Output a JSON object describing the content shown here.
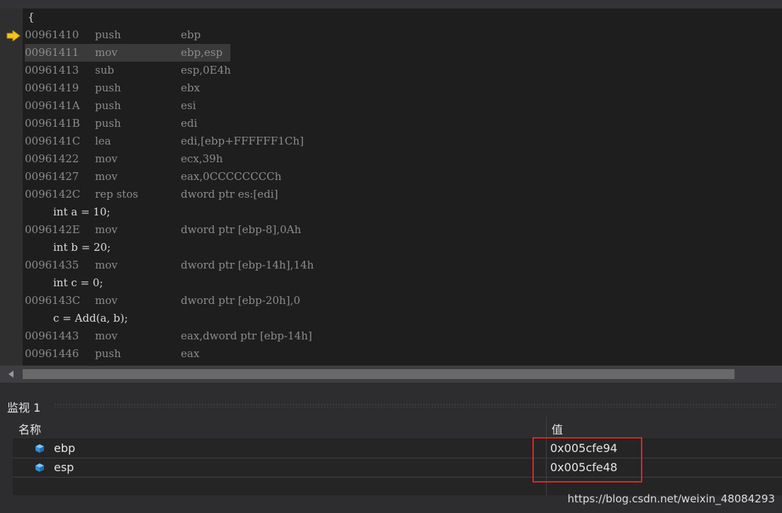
{
  "disassembly": {
    "lines": [
      {
        "type": "src",
        "text": "{"
      },
      {
        "type": "asm",
        "addr": "00961410",
        "op": "push",
        "arg": "ebp",
        "current": true
      },
      {
        "type": "asm",
        "addr": "00961411",
        "op": "mov",
        "arg": "ebp,esp",
        "highlight": true
      },
      {
        "type": "asm",
        "addr": "00961413",
        "op": "sub",
        "arg": "esp,0E4h"
      },
      {
        "type": "asm",
        "addr": "00961419",
        "op": "push",
        "arg": "ebx"
      },
      {
        "type": "asm",
        "addr": "0096141A",
        "op": "push",
        "arg": "esi"
      },
      {
        "type": "asm",
        "addr": "0096141B",
        "op": "push",
        "arg": "edi"
      },
      {
        "type": "asm",
        "addr": "0096141C",
        "op": "lea",
        "arg": "edi,[ebp+FFFFFF1Ch]"
      },
      {
        "type": "asm",
        "addr": "00961422",
        "op": "mov",
        "arg": "ecx,39h"
      },
      {
        "type": "asm",
        "addr": "00961427",
        "op": "mov",
        "arg": "eax,0CCCCCCCCh"
      },
      {
        "type": "asm",
        "addr": "0096142C",
        "op": "rep stos",
        "arg": "dword ptr es:[edi]"
      },
      {
        "type": "src",
        "text": "int a = 10;"
      },
      {
        "type": "asm",
        "addr": "0096142E",
        "op": "mov",
        "arg": "dword ptr [ebp-8],0Ah"
      },
      {
        "type": "src",
        "text": "int b = 20;"
      },
      {
        "type": "asm",
        "addr": "00961435",
        "op": "mov",
        "arg": "dword ptr [ebp-14h],14h"
      },
      {
        "type": "src",
        "text": "int c = 0;"
      },
      {
        "type": "asm",
        "addr": "0096143C",
        "op": "mov",
        "arg": "dword ptr [ebp-20h],0"
      },
      {
        "type": "src",
        "text": "c = Add(a, b);"
      },
      {
        "type": "asm",
        "addr": "00961443",
        "op": "mov",
        "arg": "eax,dword ptr [ebp-14h]"
      },
      {
        "type": "asm",
        "addr": "00961446",
        "op": "push",
        "arg": "eax"
      }
    ]
  },
  "watch": {
    "title": "监视 1",
    "col_name": "名称",
    "col_value": "值",
    "rows": [
      {
        "name": "ebp",
        "value": "0x005cfe94"
      },
      {
        "name": "esp",
        "value": "0x005cfe48"
      }
    ]
  },
  "watermark": "https://blog.csdn.net/weixin_48084293",
  "colors": {
    "highlight_box": "#e02424",
    "arrow": "#f5c518",
    "var_icon": "#3fa9f5"
  },
  "icons": {
    "current_line": "arrow-right-icon",
    "watch_var": "variable-cube-icon"
  }
}
